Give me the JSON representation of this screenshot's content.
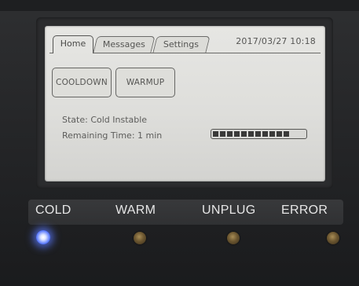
{
  "tabs": {
    "home": "Home",
    "messages": "Messages",
    "settings": "Settings"
  },
  "datetime": "2017/03/27 10:18",
  "buttons": {
    "cooldown": "COOLDOWN",
    "warmup": "WARMUP"
  },
  "status": {
    "state": "State: Cold Instable",
    "remaining": "Remaining Time: 1 min",
    "progress_fraction": 1.0,
    "progress_segments": 11
  },
  "indicators": [
    {
      "label": "COLD",
      "lit": true,
      "color": "#5b7bff"
    },
    {
      "label": "WARM",
      "lit": false,
      "color": "#6b5630"
    },
    {
      "label": "UNPLUG",
      "lit": false,
      "color": "#6b5630"
    },
    {
      "label": "ERROR",
      "lit": false,
      "color": "#6b5630"
    }
  ]
}
